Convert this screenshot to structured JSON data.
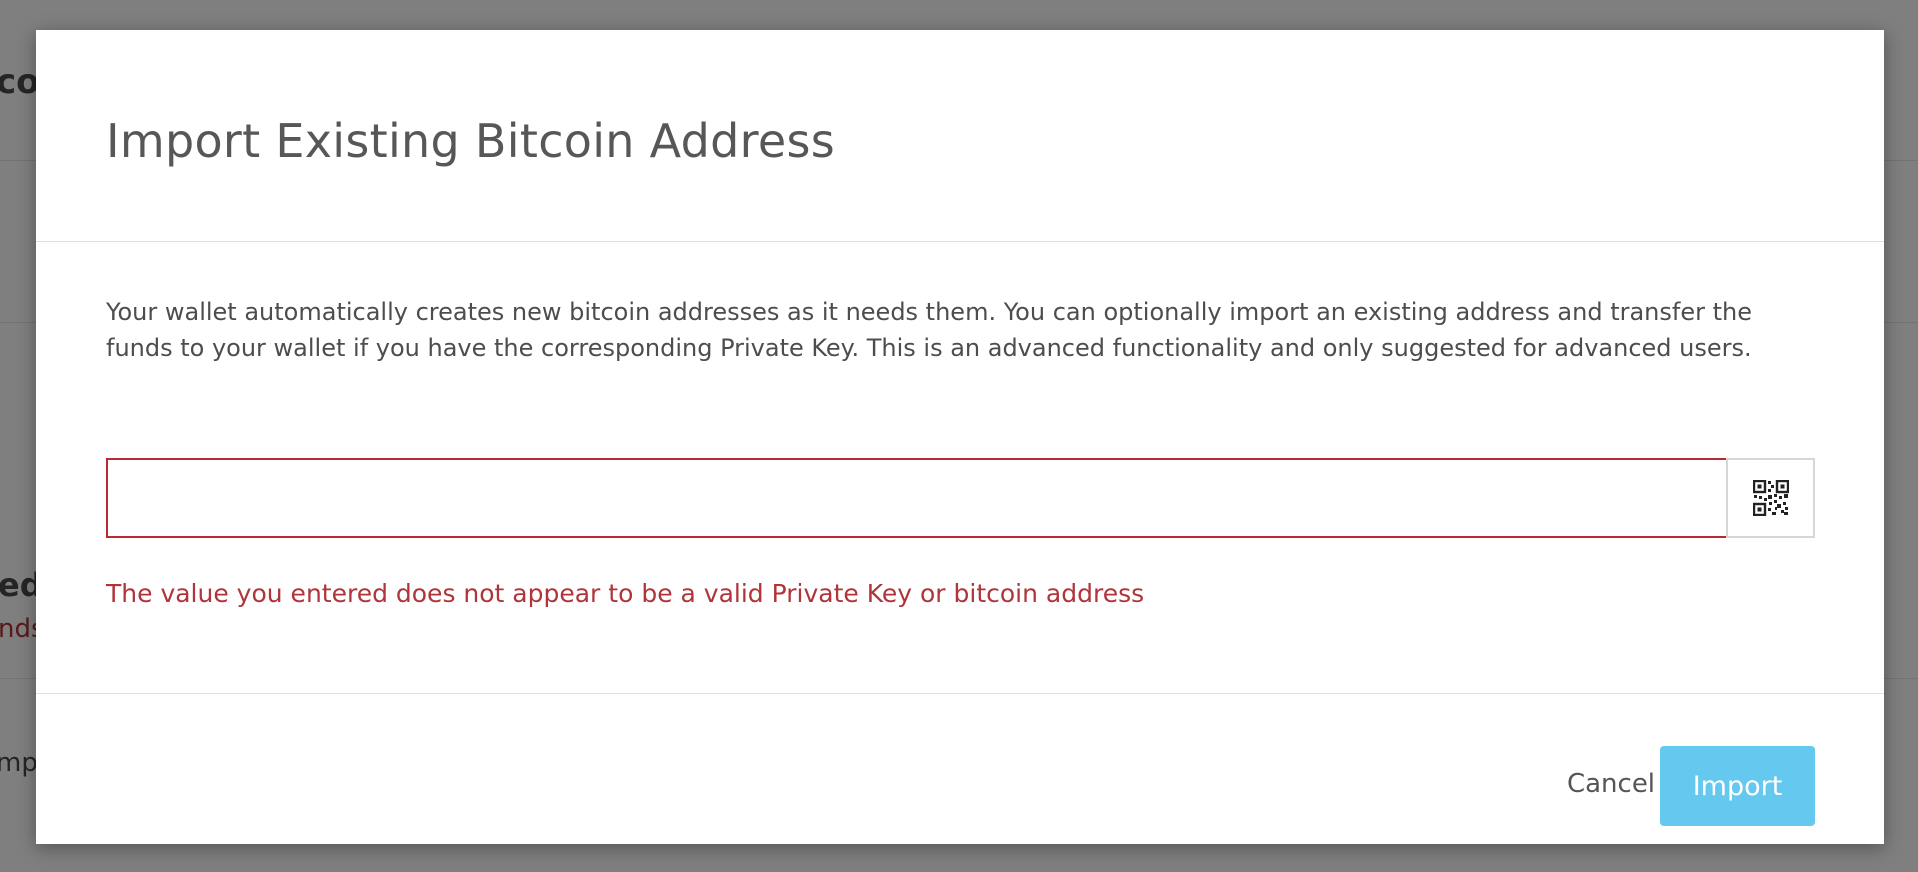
{
  "background": {
    "fragments": [
      "coi",
      "ed",
      "nds",
      "mpo"
    ]
  },
  "modal": {
    "title": "Import Existing Bitcoin Address",
    "description": "Your wallet automatically creates new bitcoin addresses as it needs them. You can optionally import an existing address and transfer the funds to your wallet if you have the corresponding Private Key. This is an advanced functionality and only suggested for advanced users.",
    "address_input": {
      "value": "",
      "placeholder": ""
    },
    "qr_button_icon": "qr-code-icon",
    "error": "The value you entered does not appear to be a valid Private Key or bitcoin address",
    "cancel_label": "Cancel",
    "import_label": "Import"
  },
  "colors": {
    "error": "#b0343a",
    "input_error_border": "#b72b34",
    "primary_button": "#65c8ef",
    "title": "#575757",
    "overlay": "rgba(0,0,0,0.5)"
  }
}
